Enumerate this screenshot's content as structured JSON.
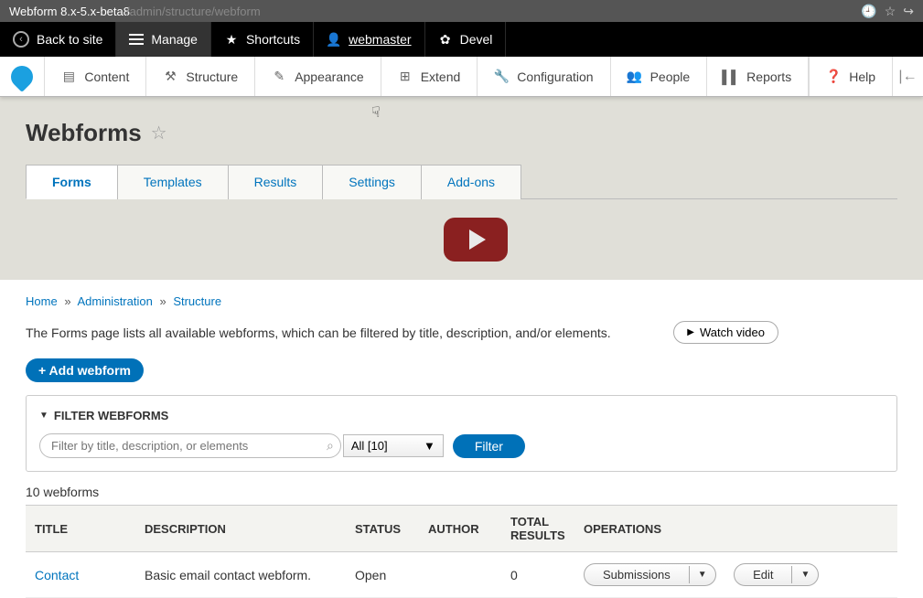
{
  "browser": {
    "title": "Webform 8.x-5.x-beta8",
    "url": "/admin/structure/webform"
  },
  "topbar": {
    "back": "Back to site",
    "manage": "Manage",
    "shortcuts": "Shortcuts",
    "user": "webmaster",
    "devel": "Devel"
  },
  "adminMenu": {
    "content": "Content",
    "structure": "Structure",
    "appearance": "Appearance",
    "extend": "Extend",
    "configuration": "Configuration",
    "people": "People",
    "reports": "Reports",
    "help": "Help"
  },
  "page": {
    "title": "Webforms"
  },
  "tabs": {
    "forms": "Forms",
    "templates": "Templates",
    "results": "Results",
    "settings": "Settings",
    "addons": "Add-ons"
  },
  "breadcrumb": {
    "home": "Home",
    "admin": "Administration",
    "structure": "Structure"
  },
  "desc": "The Forms page lists all available webforms, which can be filtered by title, description, and/or elements.",
  "watch": "Watch video",
  "add": "+ Add webform",
  "filter": {
    "title": "FILTER WEBFORMS",
    "placeholder": "Filter by title, description, or elements",
    "select": "All [10]",
    "button": "Filter"
  },
  "count": "10 webforms",
  "table": {
    "headers": {
      "title": "TITLE",
      "description": "DESCRIPTION",
      "status": "STATUS",
      "author": "AUTHOR",
      "total": "TOTAL RESULTS",
      "operations": "OPERATIONS"
    },
    "rows": [
      {
        "title": "Contact",
        "description": "Basic email contact webform.",
        "status": "Open",
        "author": "",
        "total": "0",
        "op1": "Submissions",
        "op2": "Edit"
      }
    ]
  }
}
